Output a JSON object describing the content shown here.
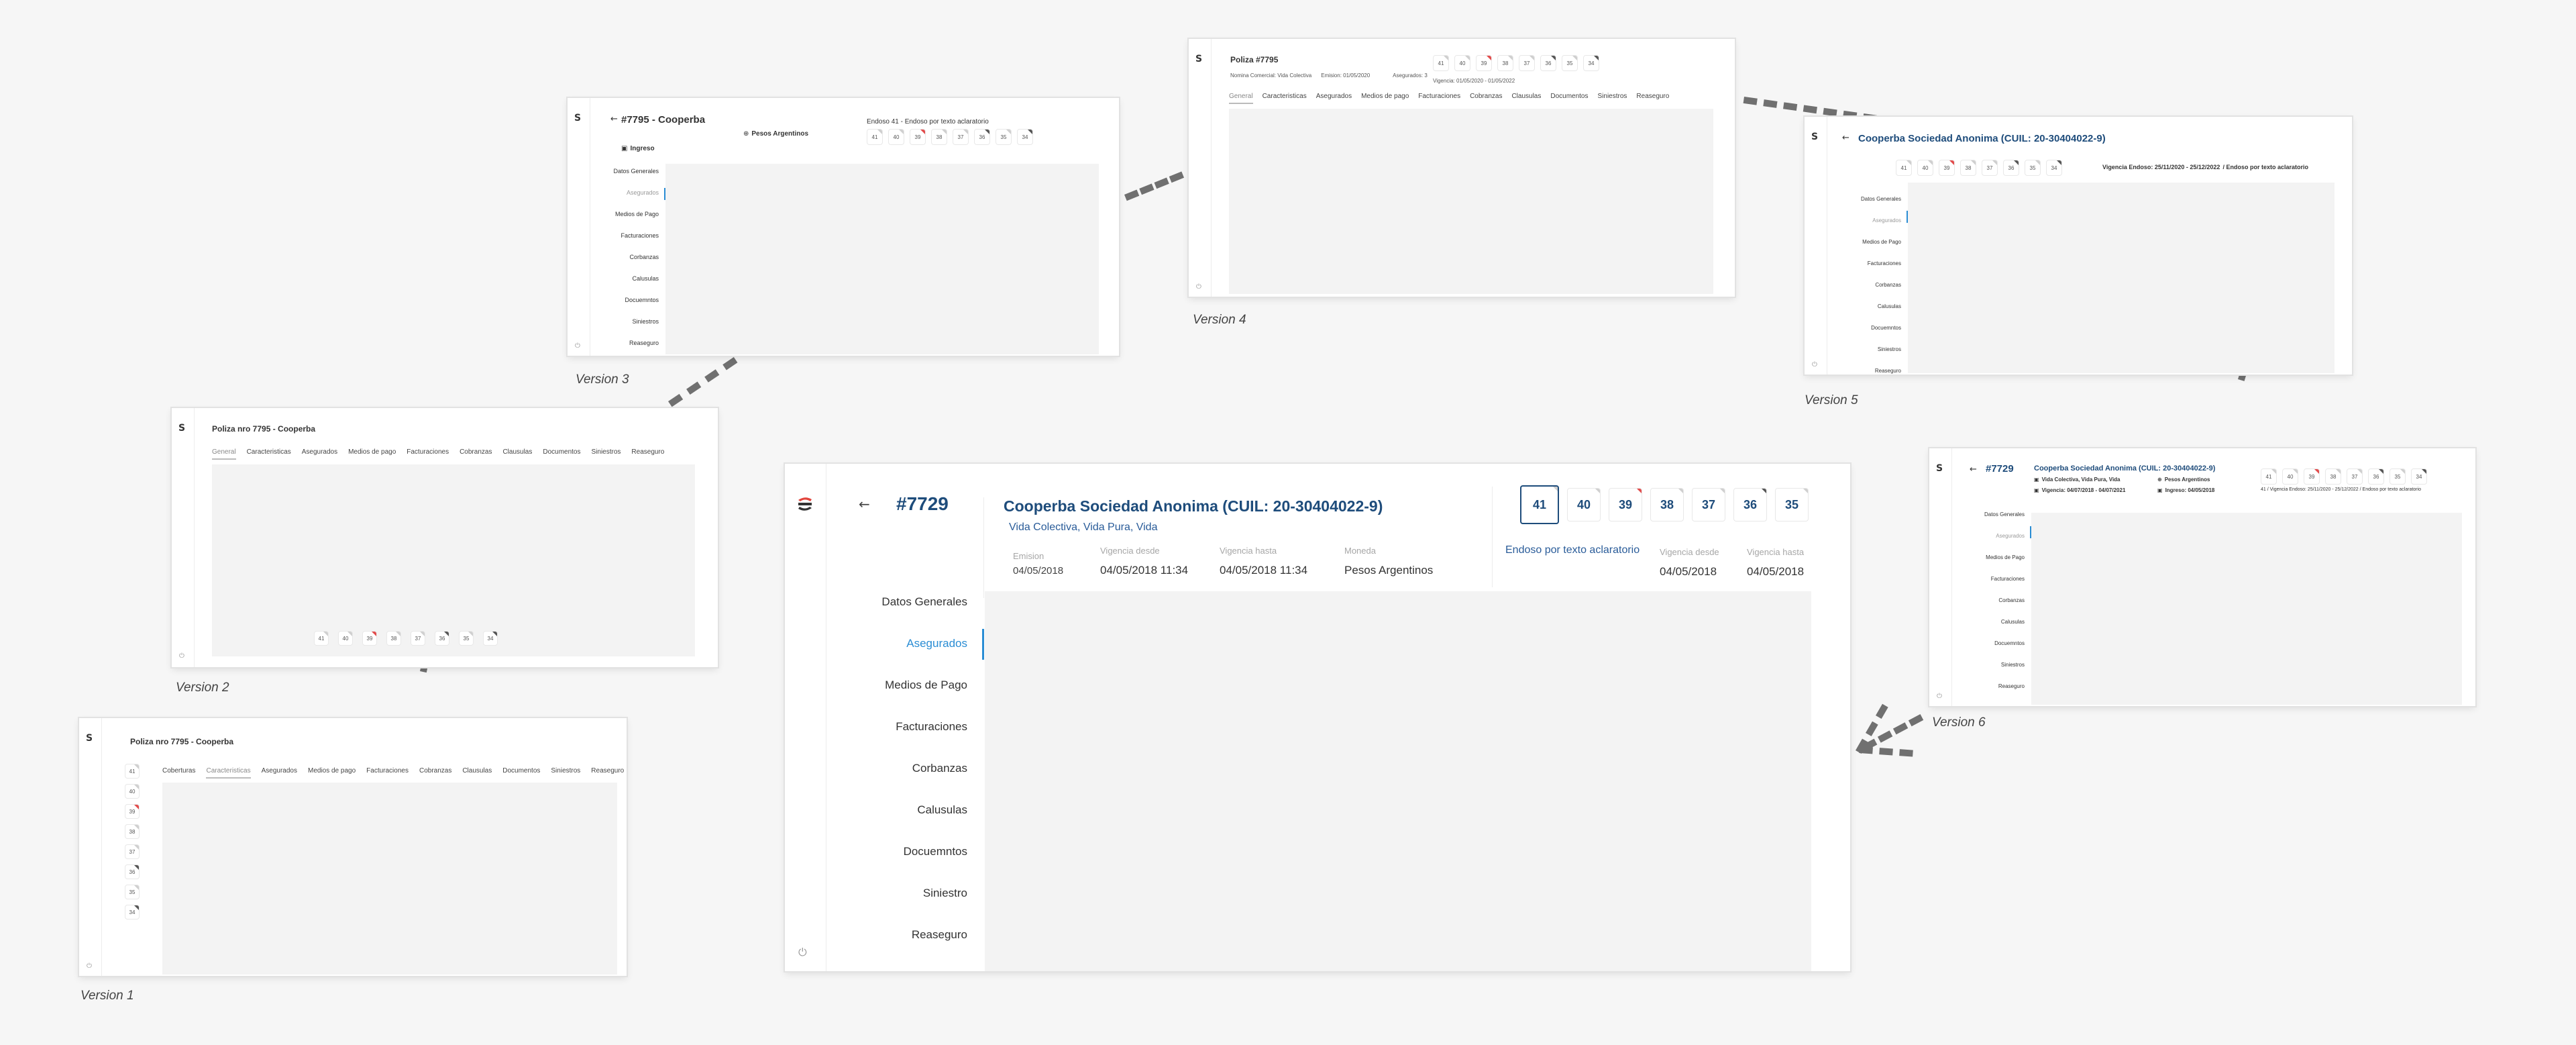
{
  "versions": {
    "v1": "Version 1",
    "v2": "Version 2",
    "v3": "Version 3",
    "v4": "Version 4",
    "v5": "Version 5",
    "v6": "Version 6"
  },
  "logo_glyph": "S",
  "icons": {
    "back": "←",
    "power": "⏻",
    "calendar": "▣",
    "globe": "⊕"
  },
  "colors": {
    "accent_blue": "#2a8dd4",
    "title_navy": "#1e4c7b",
    "badge_red": "#e24b4b",
    "badge_yellow": "#f0c23a"
  },
  "endosos": [
    "41",
    "40",
    "39",
    "38",
    "37",
    "36",
    "35",
    "34"
  ],
  "v1": {
    "title": "Poliza nro 7795 - Cooperba",
    "tabs": [
      "Coberturas",
      "Caracteristicas",
      "Asegurados",
      "Medios de pago",
      "Facturaciones",
      "Cobranzas",
      "Clausulas",
      "Documentos",
      "Siniestros",
      "Reaseguro"
    ],
    "active_tab": 1
  },
  "v2": {
    "title": "Poliza nro 7795 - Cooperba",
    "tabs": [
      "General",
      "Caracteristicas",
      "Asegurados",
      "Medios de pago",
      "Facturaciones",
      "Cobranzas",
      "Clausulas",
      "Documentos",
      "Siniestros",
      "Reaseguro"
    ],
    "active_tab": 0
  },
  "v3": {
    "title": "#7795 - Cooperba",
    "ingreso": "Ingreso",
    "moneda": "Pesos Argentinos",
    "endoso_label": "Endoso 41 - Endoso por texto aclaratorio",
    "menu": [
      "Datos Generales",
      "Asegurados",
      "Medios de Pago",
      "Facturaciones",
      "Corbanzas",
      "Calusulas",
      "Docuemntos",
      "Siniestros",
      "Reaseguro"
    ],
    "active_menu": 1
  },
  "v4": {
    "title": "Poliza #7795",
    "meta1": "Nomina Comercial: Vida Colectiva",
    "meta2": "Emision: 01/05/2020",
    "meta3": "Asegurados: 3",
    "meta4": "Vigencia: 01/05/2020 - 01/05/2022",
    "tabs": [
      "General",
      "Caracteristicas",
      "Asegurados",
      "Medios de pago",
      "Facturaciones",
      "Cobranzas",
      "Clausulas",
      "Documentos",
      "Siniestros",
      "Reaseguro"
    ],
    "active_tab": 0
  },
  "v5": {
    "title": "Cooperba Sociedad Anonima (CUIL: 20-30404022-9)",
    "endoso_info": "Vigencia Endoso: 25/11/2020 - 25/12/2022",
    "endoso_type": "/ Endoso por texto aclaratorio",
    "menu": [
      "Datos Generales",
      "Asegurados",
      "Medios de Pago",
      "Facturaciones",
      "Corbanzas",
      "Calusulas",
      "Docuemntos",
      "Siniestros",
      "Reaseguro"
    ],
    "active_menu": 1
  },
  "v6": {
    "policy": "#7729",
    "title": "Cooperba Sociedad Anonima (CUIL: 20-30404022-9)",
    "ramo": "Vida Colectiva, Vida Pura, Vida",
    "moneda": "Pesos Argentinos",
    "vigencia": "Vigencia: 04/07/2018 - 04/07/2021",
    "ingreso": "Ingreso: 04/05/2018",
    "endoso_info": "41 / Vigencia Endoso: 25/11/2020 - 25/12/2022 / Endoso por texto aclaratorio",
    "menu": [
      "Datos Generales",
      "Asegurados",
      "Medios de Pago",
      "Facturaciones",
      "Corbanzas",
      "Calusulas",
      "Docuemntos",
      "Siniestros",
      "Reaseguro"
    ],
    "active_menu": 1
  },
  "main": {
    "policy": "#7729",
    "title": "Cooperba Sociedad Anonima (CUIL: 20-30404022-9)",
    "ramo": "Vida Colectiva, Vida Pura, Vida",
    "emision_label": "Emision",
    "emision": "04/05/2018",
    "vig_desde_label": "Vigencia desde",
    "vig_desde": "04/05/2018 11:34",
    "vig_hasta_label": "Vigencia hasta",
    "vig_hasta": "04/05/2018 11:34",
    "moneda_label": "Moneda",
    "moneda": "Pesos Argentinos",
    "endoso_type": "Endoso por texto aclaratorio",
    "e_desde_label": "Vigencia desde",
    "e_desde": "04/05/2018",
    "e_hasta_label": "Vigencia hasta",
    "e_hasta": "04/05/2018",
    "endosos": [
      "41",
      "40",
      "39",
      "38",
      "37",
      "36",
      "35"
    ],
    "menu": [
      "Datos Generales",
      "Asegurados",
      "Medios de Pago",
      "Facturaciones",
      "Corbanzas",
      "Calusulas",
      "Docuemntos",
      "Siniestro",
      "Reaseguro"
    ],
    "active_menu": 1
  }
}
